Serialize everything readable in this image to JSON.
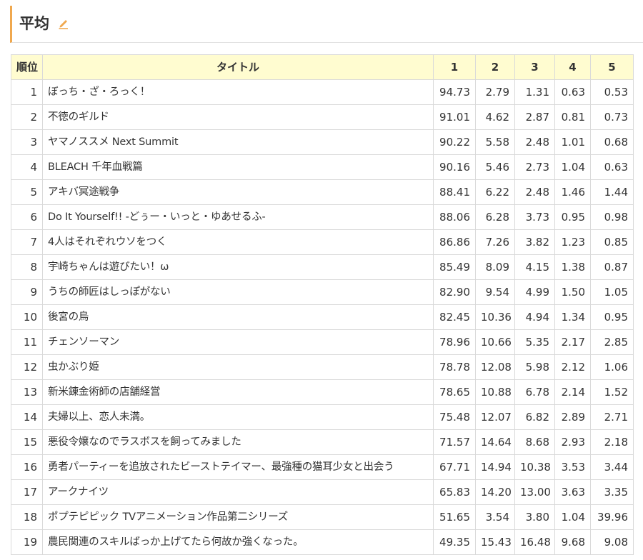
{
  "heading": {
    "title": "平均",
    "edit_icon": "pencil-icon",
    "accent_color": "#f0a84e"
  },
  "table": {
    "header_bg": "#fffcd0",
    "columns": [
      "順位",
      "タイトル",
      "1",
      "2",
      "3",
      "4",
      "5"
    ],
    "rows": [
      {
        "rank": "1",
        "title": "ぼっち・ざ・ろっく！",
        "v1": "94.73",
        "v2": "2.79",
        "v3": "1.31",
        "v4": "0.63",
        "v5": "0.53"
      },
      {
        "rank": "2",
        "title": "不徳のギルド",
        "v1": "91.01",
        "v2": "4.62",
        "v3": "2.87",
        "v4": "0.81",
        "v5": "0.73"
      },
      {
        "rank": "3",
        "title": "ヤマノススメ Next Summit",
        "v1": "90.22",
        "v2": "5.58",
        "v3": "2.48",
        "v4": "1.01",
        "v5": "0.68"
      },
      {
        "rank": "4",
        "title": "BLEACH 千年血戦篇",
        "v1": "90.16",
        "v2": "5.46",
        "v3": "2.73",
        "v4": "1.04",
        "v5": "0.63"
      },
      {
        "rank": "5",
        "title": "アキバ冥途戦争",
        "v1": "88.41",
        "v2": "6.22",
        "v3": "2.48",
        "v4": "1.46",
        "v5": "1.44"
      },
      {
        "rank": "6",
        "title": "Do It Yourself!! -どぅー・いっと・ゆあせるふ-",
        "v1": "88.06",
        "v2": "6.28",
        "v3": "3.73",
        "v4": "0.95",
        "v5": "0.98"
      },
      {
        "rank": "7",
        "title": "4人はそれぞれウソをつく",
        "v1": "86.86",
        "v2": "7.26",
        "v3": "3.82",
        "v4": "1.23",
        "v5": "0.85"
      },
      {
        "rank": "8",
        "title": "宇崎ちゃんは遊びたい！ω",
        "v1": "85.49",
        "v2": "8.09",
        "v3": "4.15",
        "v4": "1.38",
        "v5": "0.87"
      },
      {
        "rank": "9",
        "title": "うちの師匠はしっぽがない",
        "v1": "82.90",
        "v2": "9.54",
        "v3": "4.99",
        "v4": "1.50",
        "v5": "1.05"
      },
      {
        "rank": "10",
        "title": "後宮の烏",
        "v1": "82.45",
        "v2": "10.36",
        "v3": "4.94",
        "v4": "1.34",
        "v5": "0.95"
      },
      {
        "rank": "11",
        "title": "チェンソーマン",
        "v1": "78.96",
        "v2": "10.66",
        "v3": "5.35",
        "v4": "2.17",
        "v5": "2.85"
      },
      {
        "rank": "12",
        "title": "虫かぶり姫",
        "v1": "78.78",
        "v2": "12.08",
        "v3": "5.98",
        "v4": "2.12",
        "v5": "1.06"
      },
      {
        "rank": "13",
        "title": "新米錬金術師の店舗経営",
        "v1": "78.65",
        "v2": "10.88",
        "v3": "6.78",
        "v4": "2.14",
        "v5": "1.52"
      },
      {
        "rank": "14",
        "title": "夫婦以上、恋人未満。",
        "v1": "75.48",
        "v2": "12.07",
        "v3": "6.82",
        "v4": "2.89",
        "v5": "2.71"
      },
      {
        "rank": "15",
        "title": "悪役令嬢なのでラスボスを飼ってみました",
        "v1": "71.57",
        "v2": "14.64",
        "v3": "8.68",
        "v4": "2.93",
        "v5": "2.18"
      },
      {
        "rank": "16",
        "title": "勇者パーティーを追放されたビーストテイマー、最強種の猫耳少女と出会う",
        "v1": "67.71",
        "v2": "14.94",
        "v3": "10.38",
        "v4": "3.53",
        "v5": "3.44"
      },
      {
        "rank": "17",
        "title": "アークナイツ",
        "v1": "65.83",
        "v2": "14.20",
        "v3": "13.00",
        "v4": "3.63",
        "v5": "3.35"
      },
      {
        "rank": "18",
        "title": "ポプテピピック TVアニメーション作品第二シリーズ",
        "v1": "51.65",
        "v2": "3.54",
        "v3": "3.80",
        "v4": "1.04",
        "v5": "39.96"
      },
      {
        "rank": "19",
        "title": "農民関連のスキルばっか上げてたら何故か強くなった。",
        "v1": "49.35",
        "v2": "15.43",
        "v3": "16.48",
        "v4": "9.68",
        "v5": "9.08"
      }
    ]
  }
}
